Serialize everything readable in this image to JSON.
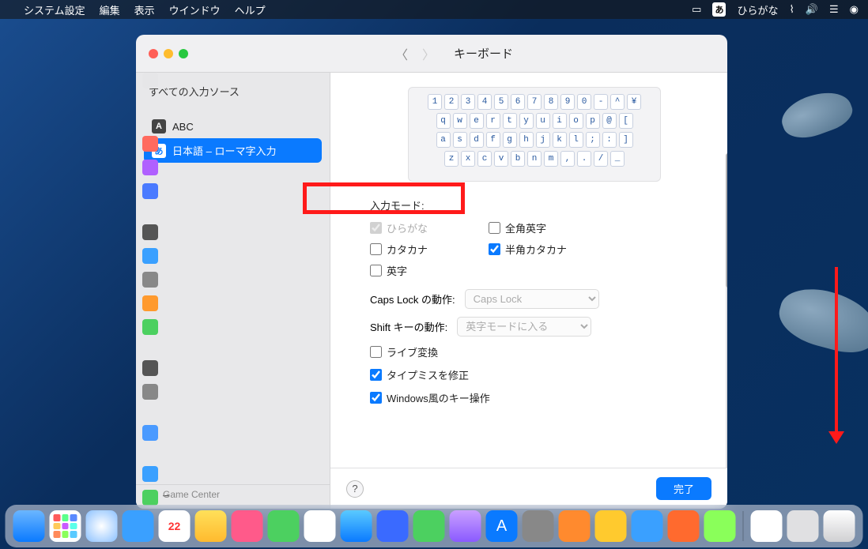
{
  "menubar": {
    "app": "システム設定",
    "items": [
      "編集",
      "表示",
      "ウインドウ",
      "ヘルプ"
    ],
    "ime_badge": "あ",
    "ime_label": "ひらがな"
  },
  "window": {
    "title": "キーボード",
    "gamecenter": "Game Center"
  },
  "sidebar": {
    "title": "すべての入力ソース",
    "sources": [
      {
        "badge": "A",
        "label": "ABC",
        "selected": false
      },
      {
        "badge": "あ",
        "label": "日本語 – ローマ字入力",
        "selected": true
      }
    ],
    "add": "+",
    "remove": "−"
  },
  "detail": {
    "keyboard_rows": [
      [
        "1",
        "2",
        "3",
        "4",
        "5",
        "6",
        "7",
        "8",
        "9",
        "0",
        "-",
        "^",
        "¥"
      ],
      [
        "q",
        "w",
        "e",
        "r",
        "t",
        "y",
        "u",
        "i",
        "o",
        "p",
        "@",
        "["
      ],
      [
        "a",
        "s",
        "d",
        "f",
        "g",
        "h",
        "j",
        "k",
        "l",
        ";",
        ":",
        "]"
      ],
      [
        "z",
        "x",
        "c",
        "v",
        "b",
        "n",
        "m",
        ",",
        ".",
        "/",
        "_"
      ]
    ],
    "input_mode_label": "入力モード:",
    "modes": [
      {
        "label": "ひらがな",
        "checked": true,
        "disabled": true
      },
      {
        "label": "全角英字",
        "checked": false,
        "disabled": false
      },
      {
        "label": "カタカナ",
        "checked": false,
        "disabled": false
      },
      {
        "label": "半角カタカナ",
        "checked": true,
        "disabled": false
      },
      {
        "label": "英字",
        "checked": false,
        "disabled": false
      }
    ],
    "capslock_label": "Caps Lock の動作:",
    "capslock_value": "Caps Lock",
    "shift_label": "Shift キーの動作:",
    "shift_value": "英字モードに入る",
    "options": [
      {
        "label": "ライブ変換",
        "checked": false
      },
      {
        "label": "タイプミスを修正",
        "checked": true
      },
      {
        "label": "Windows風のキー操作",
        "checked": true
      }
    ],
    "help": "?",
    "done": "完了"
  }
}
